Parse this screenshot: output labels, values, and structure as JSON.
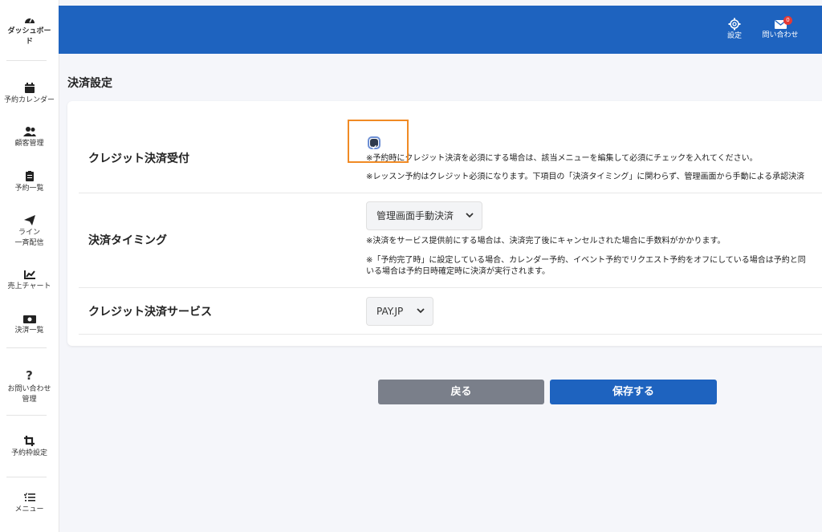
{
  "sidebar": {
    "items": [
      {
        "label": "ダッシュボード",
        "icon": "dashboard-gauge-icon"
      },
      {
        "label": "予約カレンダー",
        "icon": "calendar-icon"
      },
      {
        "label": "顧客管理",
        "icon": "users-icon"
      },
      {
        "label": "予約一覧",
        "icon": "clipboard-icon"
      },
      {
        "label": "ライン一斉配信",
        "icon": "paper-plane-icon"
      },
      {
        "label": "売上チャート",
        "icon": "chart-line-icon"
      },
      {
        "label": "決済一覧",
        "icon": "money-bill-icon"
      },
      {
        "label": "お問い合わせ管理",
        "icon": "question-icon"
      },
      {
        "label": "予約枠設定",
        "icon": "crop-icon"
      },
      {
        "label": "メニュー",
        "icon": "list-check-icon"
      }
    ],
    "dashboard_line1": "ダッシュボー",
    "dashboard_line2": "ド",
    "line_line1": "ライン",
    "line_line2": "一斉配信",
    "inquiry_line1": "お問い合わせ",
    "inquiry_line2": "管理"
  },
  "header": {
    "settings_label": "設定",
    "contact_label": "問い合わせ",
    "contact_badge": "0",
    "bg_color": "#1e63bf"
  },
  "page": {
    "title": "決済設定"
  },
  "form": {
    "credit_accept": {
      "label": "クレジット決済受付",
      "checked": true,
      "note1": "※予約時にクレジット決済を必須にする場合は、該当メニューを編集して必須にチェックを入れてください。",
      "note2": "※レッスン予約はクレジット必須になります。下項目の「決済タイミング」に関わらず、管理画面から手動による承認決済"
    },
    "timing": {
      "label": "決済タイミング",
      "selected": "管理画面手動決済",
      "note1": "※決済をサービス提供前にする場合は、決済完了後にキャンセルされた場合に手数料がかかります。",
      "note2": "※「予約完了時」に設定している場合、カレンダー予約、イベント予約でリクエスト予約をオフにしている場合は予約と同",
      "note3": "いる場合は予約日時確定時に決済が実行されます。"
    },
    "service": {
      "label": "クレジット決済サービス",
      "selected": "PAY.JP"
    }
  },
  "buttons": {
    "back_label": "戻る",
    "save_label": "保存する",
    "back_color": "#7a7f8a",
    "save_color": "#1e63bf"
  },
  "highlight_color": "#f08a24"
}
